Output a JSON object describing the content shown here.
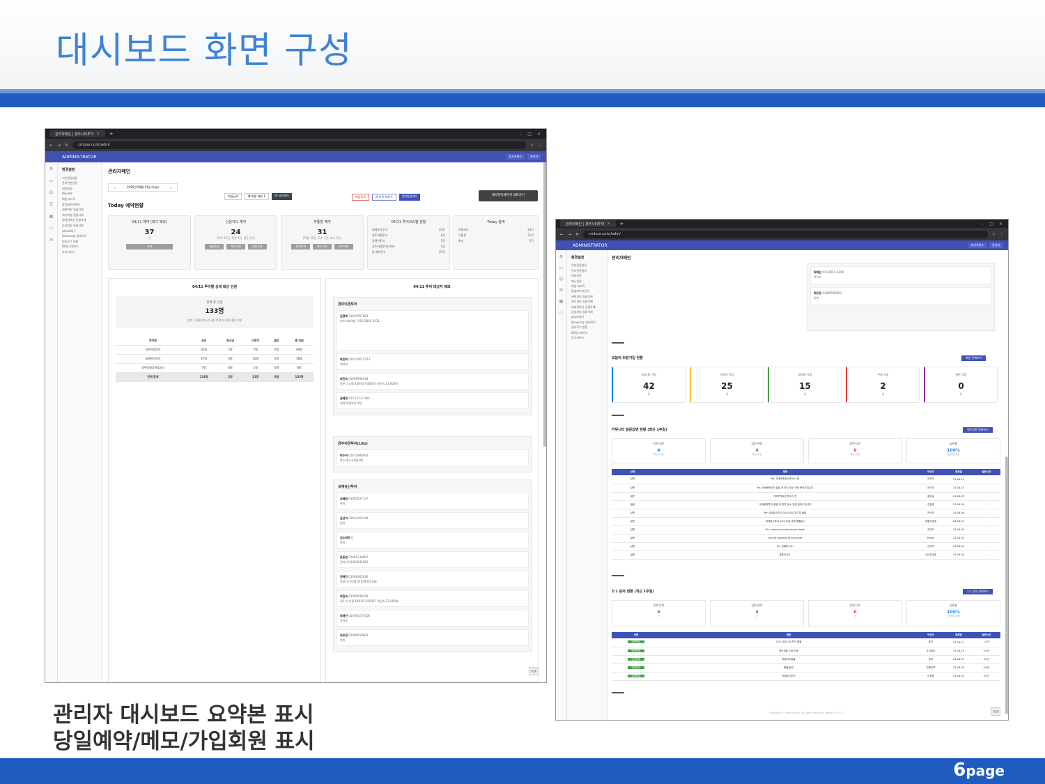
{
  "slide": {
    "title": "대시보드 화면 구성",
    "caption_line1": "관리자 대시보드 요약본 표시",
    "caption_line2": "당일예약/메모/가입회원 표시",
    "page_num": "6",
    "page_word": "page"
  },
  "browser": {
    "tab_title": "관리자메인 | 경주시티투어",
    "url": "cmtour.co.kr/adm/",
    "admin_label": "ADMINISTRATOR",
    "top_buttons": [
      "부가서비스",
      "관리자"
    ]
  },
  "sidebar": {
    "head": "환경설정",
    "items": [
      "기본환경설정",
      "관리권한설정",
      "테마설정",
      "메뉴설정",
      "메일 테스트",
      "팝업레이어관리",
      "세션파일 일괄삭제",
      "캐시파일 일괄삭제",
      "썸네일파일 일괄삭제",
      "음성파일 일괄삭제",
      "phpinfo()",
      "Browscap 업데이트",
      "접속로그 변환",
      "DB업그레이드",
      "부가서비스"
    ]
  },
  "left_page": {
    "title": "관리자메인",
    "date": "2025년 04월 11일 (오늘)",
    "mid_buttons": [
      "미입금 0",
      "예 미용 회원 1",
      "10 공지관리"
    ],
    "right_buttons": [
      "미입금 4",
      "예 미용 회원 4",
      "일반탐방관리"
    ],
    "big_button": "예약관리페이지 새로가기",
    "today_title": "Today 예약현황",
    "cards": [
      {
        "title": "04/11 예약 (대기 제외)",
        "num": "37",
        "sub": "건",
        "buttons": [
          "조회"
        ]
      },
      {
        "title": "신용카드 예약",
        "num": "24",
        "sub": "(확유 22건, 폭정 1건, 경동 2건)",
        "buttons": [
          "현황조정",
          "폭정조정",
          "경동조정"
        ]
      },
      {
        "title": "무통장 예약",
        "num": "31",
        "sub": "(확정 15건, 확소 3건, 대기 5건)",
        "buttons": [
          "확정조회",
          "확소조회",
          "대기조회"
        ]
      }
    ],
    "course_card": {
      "title": "04/11 투어코스별 현황",
      "rows": [
        [
          "세계유산투어",
          "24건"
        ],
        [
          "경주야경투어",
          "6건"
        ],
        [
          "동해안투어",
          "5건"
        ],
        [
          "경주야경투어(Lite)",
          "5건"
        ],
        [
          "총 예약건수",
          "53건"
        ]
      ]
    },
    "total_card": {
      "title": "Today 합계",
      "rows": [
        [
          "신용카드",
          "24건"
        ],
        [
          "무통장",
          "31건"
        ],
        [
          "취소",
          "2건"
        ]
      ]
    },
    "detail": {
      "title": "04/11 투어별 상세 대상 인원",
      "total_label": "전체 총 인원",
      "total_num": "133명",
      "breakdown": "성인 118명   청소년 2명   어린이 21명   할인 0명",
      "headers": [
        "투어명",
        "성인",
        "청소년",
        "어린이",
        "할인",
        "총 인원"
      ],
      "rows": [
        [
          "경주야경투어",
          "62명",
          "2명",
          "7명",
          "0명",
          "69명"
        ],
        [
          "세계유산투어",
          "47명",
          "0명",
          "12명",
          "0명",
          "58명"
        ],
        [
          "경주야경투어(Lite)",
          "7명",
          "0명",
          "1명",
          "0명",
          "8명"
        ]
      ],
      "total_row": [
        "전체 합계",
        "116명",
        "2명",
        "21명",
        "0명",
        "133명"
      ]
    },
    "memo": {
      "title": "04/11 투어 대상자 메모",
      "groups": [
        {
          "name": "경주야경투어",
          "items": [
            {
              "name": "김경화",
              "phone": "01030767683",
              "note": "버스하차요청 / 010-2842-3031"
            },
            {
              "name": "박윤희",
              "phone": "010-5065-5213",
              "note": "네이버"
            },
            {
              "name": "최민숙",
              "phone": "01099598418",
              "note": "경주시 농협 438-02-058307 최민숙 23,000원"
            },
            {
              "name": "권혜정",
              "phone": "010-7713-7981",
              "note": "네이버/할부지 확인"
            }
          ]
        },
        {
          "name": "경주야경투어(Lite)",
          "items": [
            {
              "name": "박수아",
              "phone": "01071986092",
              "note": "박수아(오)/지원(자)"
            }
          ]
        },
        {
          "name": "세계유산투어",
          "items": [
            {
              "name": "김혜원",
              "phone": "01095537737",
              "note": "현미"
            },
            {
              "name": "김선미",
              "phone": "01042166149",
              "note": "현미"
            },
            {
              "name": "김소희야",
              "phone": "0",
              "note": "현미"
            },
            {
              "name": "윤중현",
              "phone": "01091238687",
              "note": "전미자 01082845662"
            },
            {
              "name": "정해진",
              "phone": "01098365246",
              "note": "정쌍자 미인행 01059345348"
            },
            {
              "name": "최민숙",
              "phone": "01099598418",
              "note": "경3-가 농협 438-02-058307 최민숙 23,000원"
            },
            {
              "name": "최재선",
              "phone": "010-8515-0306",
              "note": "카카오"
            },
            {
              "name": "최유정",
              "phone": "01089559893",
              "note": "현미"
            }
          ]
        }
      ]
    }
  },
  "right_page": {
    "title": "관리자메인",
    "memo_top": [
      {
        "name": "최재선",
        "phone": "010-8515-0306",
        "note": "카카오"
      },
      {
        "name": "최유정",
        "phone": "01089559893",
        "note": "현미"
      }
    ],
    "signup_title": "오늘의 회원가입 현황",
    "signup_button": "회원 전체보기",
    "signup_cards": [
      {
        "label": "오늘 총 가입",
        "num": "42",
        "unit": "명",
        "color": "#1e88e5"
      },
      {
        "label": "카카오 가입",
        "num": "25",
        "unit": "명",
        "color": "#fbc02d"
      },
      {
        "label": "네이버 가입",
        "num": "15",
        "unit": "명",
        "color": "#43a047"
      },
      {
        "label": "구글 가입",
        "num": "2",
        "unit": "명",
        "color": "#e53935"
      },
      {
        "label": "일반 가입",
        "num": "0",
        "unit": "명",
        "color": "#8e24aa"
      }
    ],
    "qa_title": "커뮤니티 질문답변 현황 (최근 1주일)",
    "qa_button": "질문답변 전체보기",
    "qa_stats": [
      {
        "label": "전체 질문",
        "num": "4",
        "unit": "최근 1주일",
        "color": "#1e88e5"
      },
      {
        "label": "답변 완료",
        "num": "4",
        "unit": "최근 1주일",
        "color": "#43a047"
      },
      {
        "label": "답변 대기",
        "num": "0",
        "unit": "최근 1주일",
        "color": "#e53935"
      },
      {
        "label": "답변율",
        "num": "100%",
        "unit": "답변완료/전체",
        "color": "#1e88e5"
      }
    ],
    "qa_headers": [
      "상태",
      "제목",
      "작성자",
      "등록일",
      "답변시간"
    ],
    "qa_rows": [
      [
        "답변",
        "Re: 세계문화유산투어시 문",
        "관리자",
        "25-04-10",
        "-"
      ],
      [
        "답변",
        "Re: 세계문화투어 출발 후 하차 장소 관련 문의드립니다",
        "관리자",
        "25-04-10",
        "-"
      ],
      [
        "질문",
        "세계문화유산투어시 문",
        "홍영실",
        "25-04-09",
        "-"
      ],
      [
        "질문",
        "세계문화투어 출발 후 하차 장소 관련 문의드립니다",
        "김현정",
        "25-04-09",
        "-"
      ],
      [
        "답변",
        "Re: 세계유산투어 10시30분 경주역 출발",
        "관리자",
        "25-04-08",
        "-"
      ],
      [
        "질문",
        "세계유산투어 10시30분 경주역출발시",
        "위험자호경",
        "25-04-07",
        "-"
      ],
      [
        "답변",
        "Re: cannot proceed to purchase",
        "관리자",
        "25-04-05",
        "-"
      ],
      [
        "질문",
        "cannot proceed to purchase",
        "Micah",
        "25-04-05",
        "-"
      ],
      [
        "답변",
        "Re: 공룡하시오.",
        "관리자",
        "25-04-04",
        "-"
      ],
      [
        "질문",
        "공룡하시오.",
        "나는유실회",
        "25-04-04",
        "-"
      ]
    ],
    "inq_title": "1:1 문의 현황 (최근 1주일)",
    "inq_button": "1:1 문의 전체보기",
    "inq_stats": [
      {
        "label": "전체 문의",
        "num": "6",
        "unit": "건",
        "color": "#1e88e5"
      },
      {
        "label": "답변 완료",
        "num": "6",
        "unit": "건",
        "color": "#43a047"
      },
      {
        "label": "답변 대기",
        "num": "0",
        "unit": "건",
        "color": "#e53935"
      },
      {
        "label": "답변율",
        "num": "100%",
        "unit": "답변완료/전체",
        "color": "#1e88e5"
      }
    ],
    "inq_headers": [
      "상태",
      "제목",
      "작성자",
      "등록일",
      "답변시간"
    ],
    "inq_rows": [
      [
        "답변완료",
        "4/12 야경 시티투어 환불",
        "호선",
        "25-04-11",
        "1시간"
      ],
      [
        "답변완료",
        "계산된을 수정 요청",
        "초시미로",
        "25-04-10",
        "0시간"
      ],
      [
        "답변완료",
        "부용취소환불",
        "송미",
        "25-04-07",
        "5시간"
      ],
      [
        "답변완료",
        "환불 문의",
        "다해이루",
        "25-04-05",
        "0시간"
      ],
      [
        "답변완료",
        "세계유산투어",
        "이정화",
        "25-04-05",
        "4시간"
      ]
    ],
    "copyright": "Copyright © cmtour.co.kr All rights reserved. Version 5.5.8.2"
  },
  "colors": {
    "title_blue": "#3d84d4",
    "band_blue": "#1f5cbf",
    "admin_bar": "#3f51b5"
  },
  "icons": [
    "gear-icon",
    "folder-icon",
    "user-icon",
    "list-icon",
    "chevron-left-icon",
    "chevron-right-icon",
    "close-icon",
    "top-arrow-icon"
  ]
}
